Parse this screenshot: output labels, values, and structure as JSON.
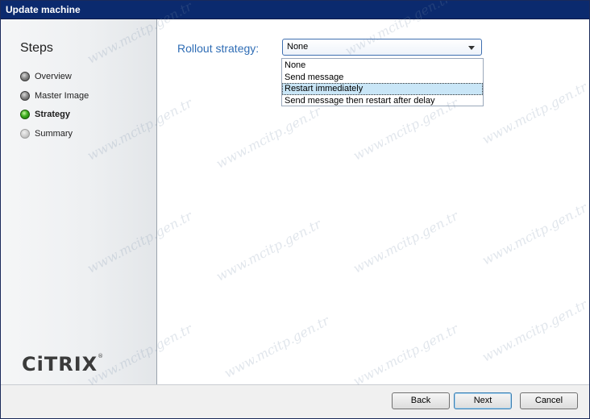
{
  "window": {
    "title": "Update machine"
  },
  "sidebar": {
    "title": "Steps",
    "steps": [
      {
        "label": "Overview",
        "state": "done"
      },
      {
        "label": "Master Image",
        "state": "done"
      },
      {
        "label": "Strategy",
        "state": "active"
      },
      {
        "label": "Summary",
        "state": "pending"
      }
    ],
    "logo": "CiTRIX",
    "logo_mark": "®"
  },
  "main": {
    "rollout_label": "Rollout strategy:",
    "rollout_select": {
      "selected": "None",
      "options": [
        "None",
        "Send message",
        "Restart immediately",
        "Send message then restart after delay"
      ],
      "highlighted_index": 2
    }
  },
  "footer": {
    "back_label": "Back",
    "next_label": "Next",
    "cancel_label": "Cancel"
  },
  "watermark": {
    "text": "www.mcitp.gen.tr"
  },
  "colors": {
    "titlebar": "#0b2a6e",
    "label_blue": "#2f6db5",
    "highlight": "#c9e6f7",
    "active_step": "#3cae1e"
  }
}
